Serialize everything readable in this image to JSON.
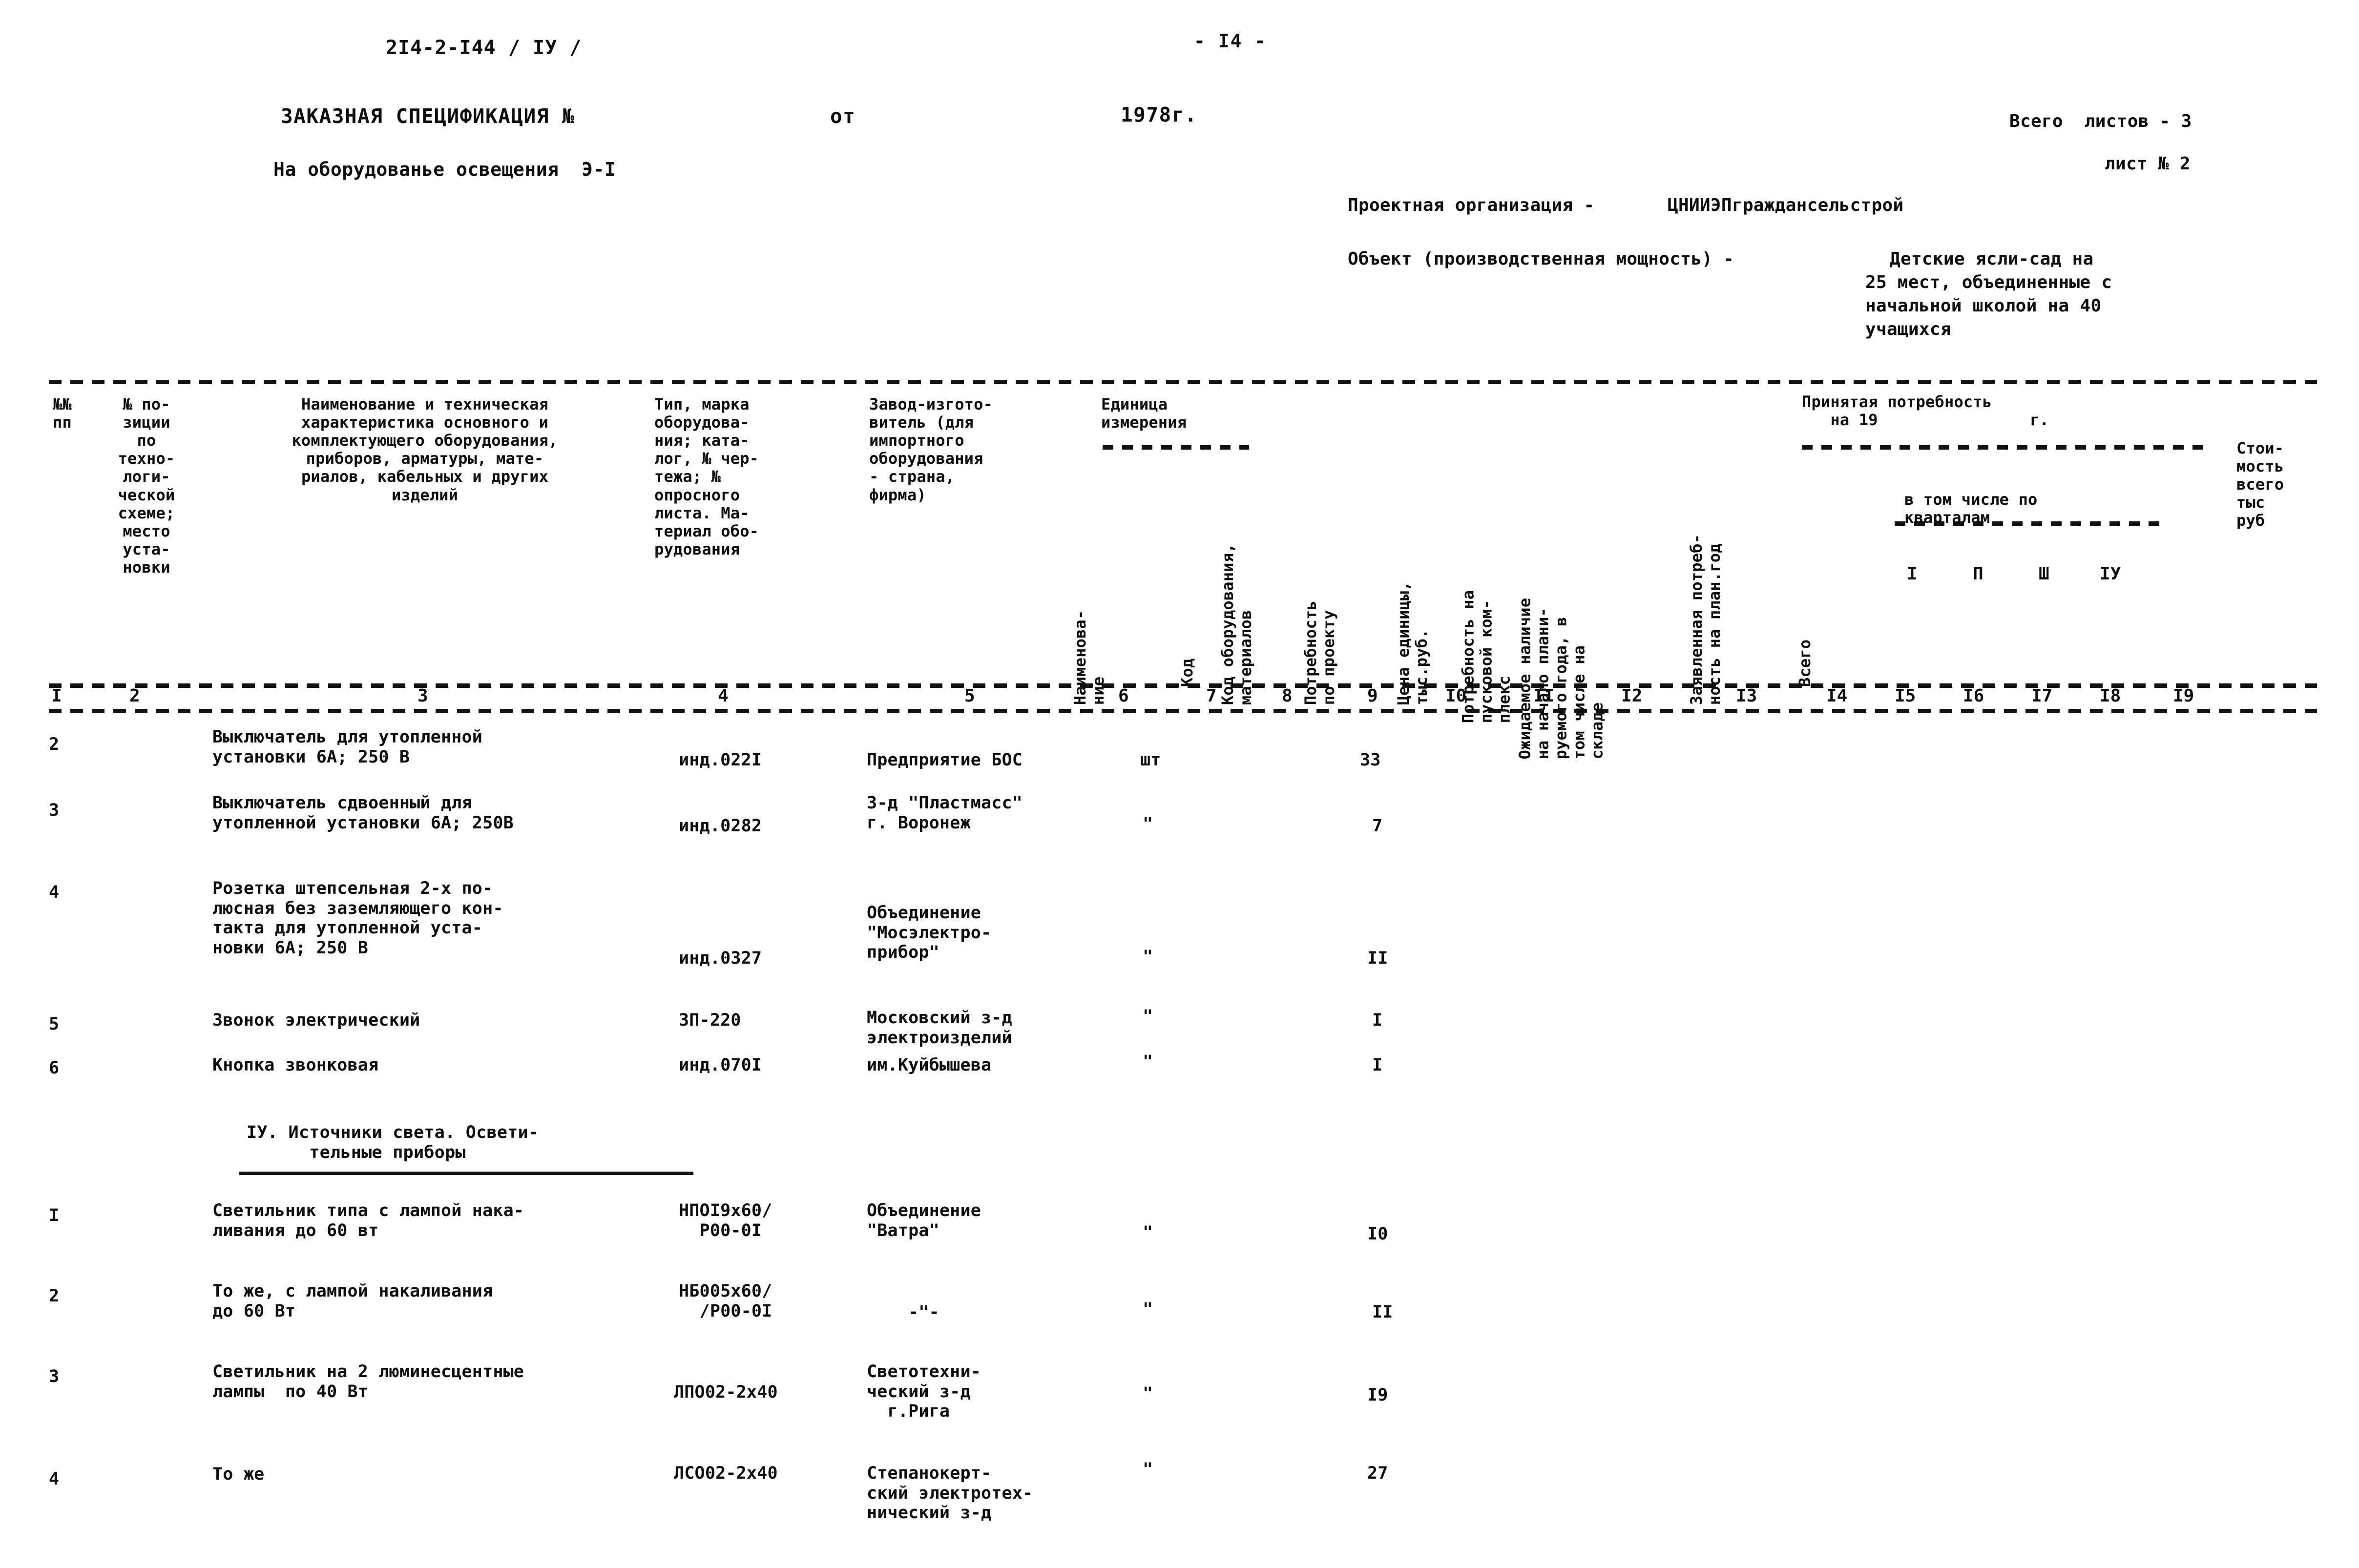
{
  "document": {
    "code": "2I4-2-I44 / IУ /",
    "page_marker": "- I4 -",
    "title": "ЗАКАЗНАЯ СПЕЦИФИКАЦИЯ №",
    "title_from": "от",
    "title_year": "1978г.",
    "subject_line": "На оборудованье освещения  Э-I",
    "sheets_total": "Всего  листов - 3",
    "sheet_number": "лист № 2",
    "design_org_label": "Проектная организация -",
    "design_org_value": "ЦНИИЭПграждансельстрой",
    "object_label": "Объект (производственная мощность) -",
    "object_value_lines": [
      "Детские ясли-сад на",
      "25 мест, объединенные с",
      "начальной школой на 40",
      "учащихся"
    ]
  },
  "table": {
    "headers": {
      "col1": "№№\nпп",
      "col2": "№ по-\nзиции\nпо\nтехно-\nлоги-\nческой\nсхеме;\nместо\nуста-\nновки",
      "col3": "Наименование и техническая\nхарактеристика основного и\nкомплектующего оборудования,\nприборов, арматуры, мате-\nриалов, кабельных и других\nизделий",
      "col4": "Тип, марка\nоборудова-\nния; ката-\nлог, № чер-\nтежа; №\nопросного\nлиста. Ма-\nтериал обо-\nрудования",
      "col5": "Завод-изгото-\nвитель (для\nимпортного\nоборудования\n- страна,\nфирма)",
      "unit_group": "Единица\nизмерения",
      "col6": "Наименова-\nние",
      "col7": "Код",
      "col8": "Код оборудования,\nматериалов",
      "col9": "Потребность\nпо проекту",
      "col10": "Цена единицы,\nтыс.руб.",
      "col11": "Потребность на\nпусковой ком-\nплекс",
      "col12": "Ожидаемое наличие\nна начало плани-\nруемого года, в\nтом числе на\nскладе",
      "col13": "Заявленная потреб-\nность на план.год",
      "accepted_group": "Принятая потребность\n   на 19                г.",
      "col14": "Всего",
      "quarters_label": "в том числе по\nкварталам",
      "col15": "I",
      "col16": "П",
      "col17": "Ш",
      "col18": "IУ",
      "col19": "Стои-\nмость\nвсего\nтыс\nруб"
    },
    "column_numbers": [
      "I",
      "2",
      "3",
      "4",
      "5",
      "6",
      "7",
      "8",
      "9",
      "I0",
      "II",
      "I2",
      "I3",
      "I4",
      "I5",
      "I6",
      "I7",
      "I8",
      "I9"
    ],
    "section_title": "IУ. Источники света. Освети-\n      тельные приборы",
    "rows": [
      {
        "no": "2",
        "name": "Выключатель для утопленной\nустановки 6А; 250 В",
        "type": "инд.022I",
        "maker": "Предприятие БОС",
        "unit": "шт",
        "qty": "33"
      },
      {
        "no": "3",
        "name": "Выключатель сдвоенный для\nутопленной установки 6А; 250В",
        "type": "инд.0282",
        "maker": "3-д \"Пластмасс\"\nг. Воронеж",
        "unit": "\"",
        "qty": "7"
      },
      {
        "no": "4",
        "name": "Розетка штепсельная 2-х по-\nлюсная без заземляющего кон-\nтакта для утопленной уста-\nновки 6А; 250 В",
        "type": "инд.0327",
        "maker": "Объединение\n\"Мосэлектро-\nприбор\"",
        "unit": "\"",
        "qty": "II"
      },
      {
        "no": "5",
        "name": "Звонок электрический",
        "type": "ЗП-220",
        "maker": "Московский з-д\nэлектроизделий",
        "unit": "\"",
        "qty": "I"
      },
      {
        "no": "6",
        "name": "Кнопка звонковая",
        "type": "инд.070I",
        "maker": "им.Куйбышева",
        "unit": "\"",
        "qty": "I"
      },
      {
        "no": "I",
        "name": "Светильник типа с лампой нака-\nливания до 60 вт",
        "type": "НПОI9х60/\n  Р00-0I",
        "maker": "Объединение\n\"Ватра\"",
        "unit": "\"",
        "qty": "I0"
      },
      {
        "no": "2",
        "name": "То же, с лампой накаливания\nдо 60 Вт",
        "type": "НБ005х60/\n  /Р00-0I",
        "maker": "-\"-",
        "unit": "\"",
        "qty": "II"
      },
      {
        "no": "3",
        "name": "Светильник на 2 люминесцентные\nлампы  по 40 Вт",
        "type": "ЛПО02-2х40",
        "maker": "Светотехни-\nческий з-д\n  г.Рига",
        "unit": "\"",
        "qty": "I9"
      },
      {
        "no": "4",
        "name": "То же",
        "type": "ЛСО02-2х40",
        "maker": "Степанокерт-\nский электротех-\nнический з-д",
        "unit": "\"",
        "qty": "27"
      }
    ]
  }
}
